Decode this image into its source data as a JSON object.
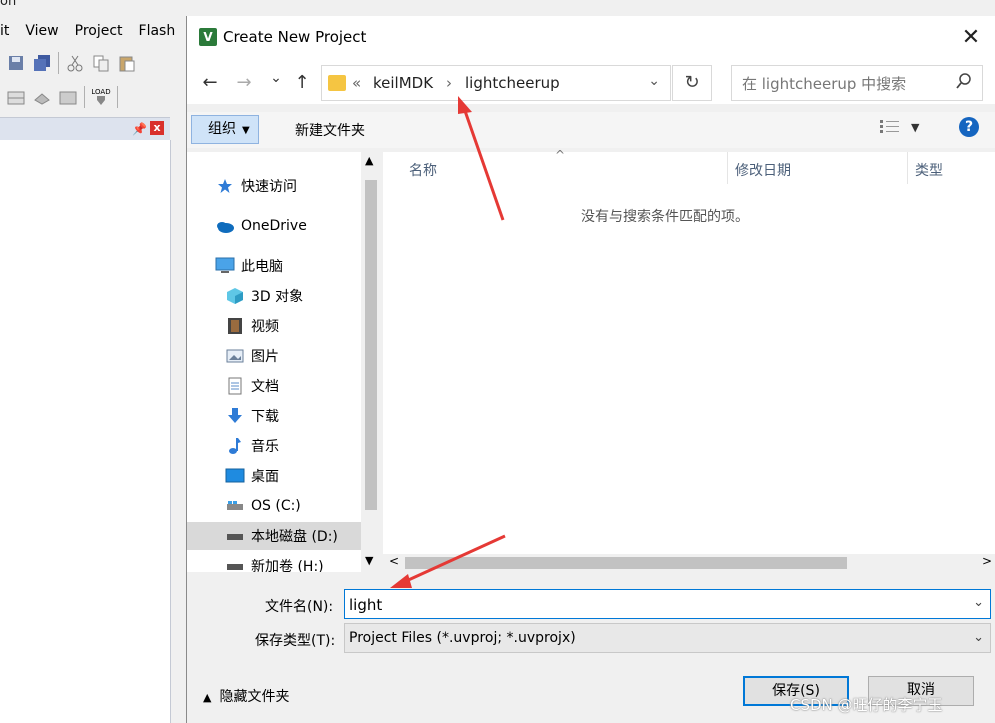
{
  "background_app": {
    "title_fragment": "on",
    "menus": [
      "it",
      "View",
      "Project",
      "Flash"
    ],
    "load_icon_text": "LOAD"
  },
  "dialog": {
    "title": "Create New Project",
    "close_label": "✕",
    "nav": {
      "back": "←",
      "forward": "→",
      "recent": "⌄",
      "up": "↑"
    },
    "address": {
      "overflow": "«",
      "crumbs": [
        "keilMDK",
        "lightcheerup"
      ],
      "separator": "›",
      "dropdown": "⌄"
    },
    "refresh": "↻",
    "search": {
      "placeholder": "在 lightcheerup 中搜索"
    },
    "toolbar": {
      "organize": "组织",
      "new_folder": "新建文件夹",
      "help": "?"
    },
    "nav_pane": {
      "items": [
        {
          "label": "快速访问",
          "icon": "star-icon"
        },
        {
          "label": "OneDrive",
          "icon": "cloud-icon"
        },
        {
          "label": "此电脑",
          "icon": "computer-icon"
        },
        {
          "label": "3D 对象",
          "icon": "cube-icon"
        },
        {
          "label": "视频",
          "icon": "film-icon"
        },
        {
          "label": "图片",
          "icon": "picture-icon"
        },
        {
          "label": "文档",
          "icon": "document-icon"
        },
        {
          "label": "下载",
          "icon": "download-icon"
        },
        {
          "label": "音乐",
          "icon": "music-icon"
        },
        {
          "label": "桌面",
          "icon": "desktop-icon"
        },
        {
          "label": "OS (C:)",
          "icon": "drive-icon"
        },
        {
          "label": "本地磁盘 (D:)",
          "icon": "drive-icon"
        },
        {
          "label": "新加卷 (H:)",
          "icon": "drive-icon"
        }
      ],
      "selected": "本地磁盘 (D:)"
    },
    "file_list": {
      "columns": [
        "名称",
        "修改日期",
        "类型"
      ],
      "empty_message": "没有与搜索条件匹配的项。"
    },
    "filename": {
      "label": "文件名(N):",
      "value": "light"
    },
    "filetype": {
      "label": "保存类型(T):",
      "value": "Project Files (*.uvproj; *.uvprojx)"
    },
    "hide_folders": "隐藏文件夹",
    "save_button": "保存(S)",
    "cancel_button": "取消"
  },
  "watermark": "CSDN @旺仔的李宁玉",
  "colors": {
    "accent": "#0078d7",
    "arrow": "#e53935",
    "folder": "#f5c542"
  }
}
